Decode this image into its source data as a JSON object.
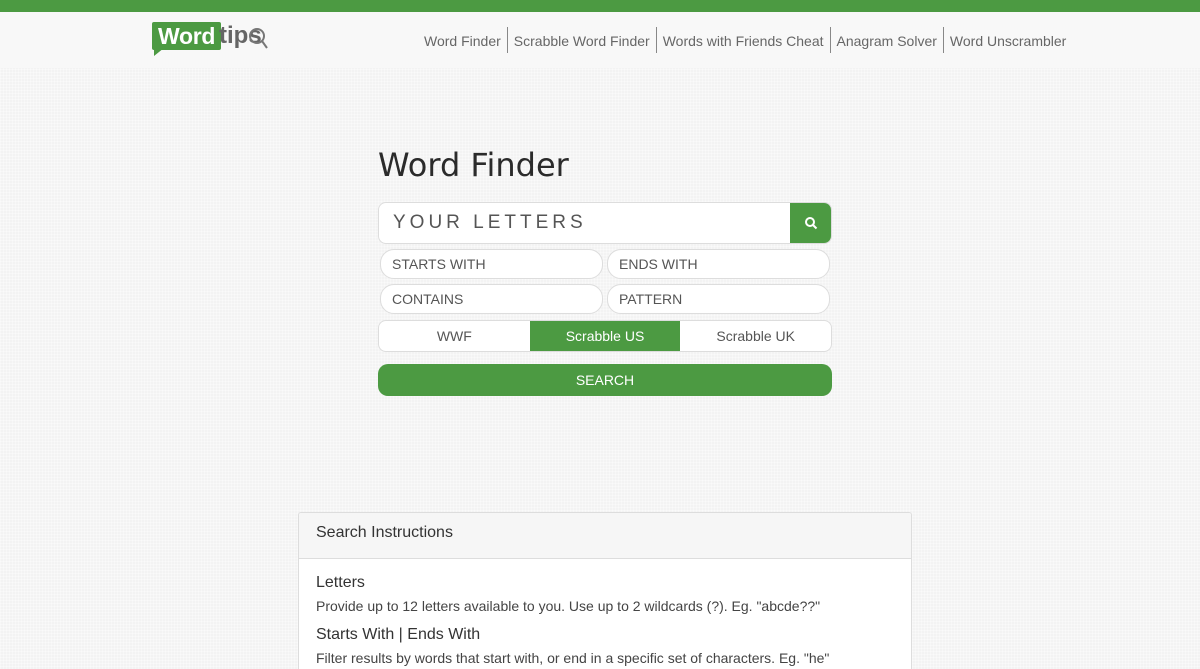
{
  "brand": {
    "logo_word": "Word",
    "logo_tips": "tips",
    "accent_color": "#4c9a42"
  },
  "nav": {
    "items": [
      {
        "label": "Word Finder"
      },
      {
        "label": "Scrabble Word Finder"
      },
      {
        "label": "Words with Friends Cheat"
      },
      {
        "label": "Anagram Solver"
      },
      {
        "label": "Word Unscrambler"
      }
    ]
  },
  "main": {
    "title": "Word Finder",
    "letters_placeholder": "YOUR LETTERS",
    "starts_with_placeholder": "STARTS WITH",
    "ends_with_placeholder": "ENDS WITH",
    "contains_placeholder": "CONTAINS",
    "pattern_placeholder": "PATTERN",
    "dictionaries": [
      {
        "label": "WWF"
      },
      {
        "label": "Scrabble US",
        "selected": true
      },
      {
        "label": "Scrabble UK"
      }
    ],
    "search_label": "SEARCH"
  },
  "instructions": {
    "heading": "Search Instructions",
    "sections": [
      {
        "title": "Letters",
        "text": "Provide up to 12 letters available to you. Use up to 2 wildcards (?). Eg. \"abcde??\""
      },
      {
        "title": "Starts With | Ends With",
        "text": "Filter results by words that start with, or end in a specific set of characters. Eg. \"he\""
      }
    ]
  }
}
